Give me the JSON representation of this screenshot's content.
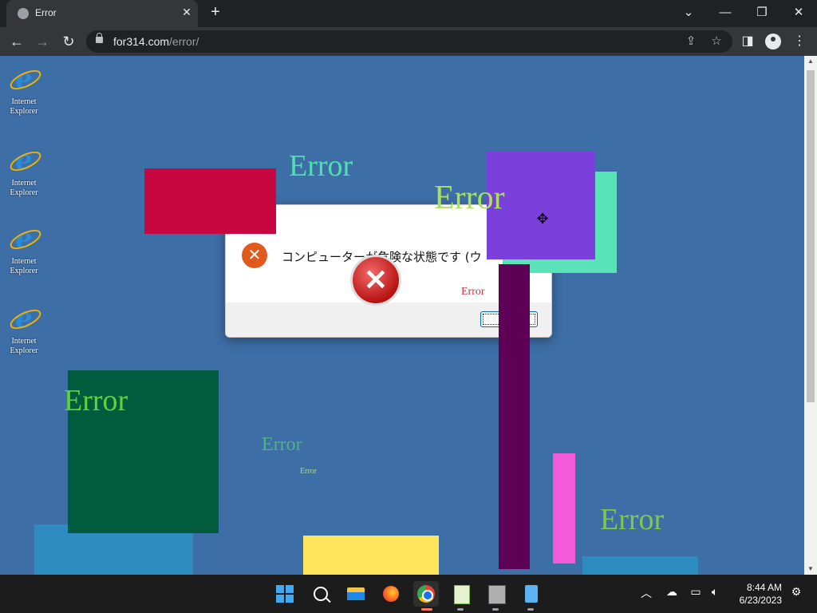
{
  "browser": {
    "tab": {
      "title": "Error"
    },
    "window_controls": {
      "tabsearch": "⌄",
      "minimize": "—",
      "restore": "❐",
      "close": "✕"
    },
    "toolbar": {
      "back": "←",
      "forward": "→",
      "reload": "↻",
      "url_host": "for314.com",
      "url_path": "/error/",
      "share": "⇪",
      "bookmark": "☆",
      "sidepanel": "◨",
      "menu": "⋮"
    }
  },
  "desktop_icons": [
    {
      "label": "Internet Explorer"
    },
    {
      "label": "Internet Explorer"
    },
    {
      "label": "Internet Explorer"
    },
    {
      "label": "Internet Explorer"
    }
  ],
  "errors": [
    {
      "text": "Error",
      "color": "#4fe0b0"
    },
    {
      "text": "Error",
      "color": "#a8e060"
    },
    {
      "text": "Error",
      "color": "#c8364a"
    },
    {
      "text": "Error",
      "color": "#5fd33a"
    },
    {
      "text": "Error",
      "color": "#4fb386"
    },
    {
      "text": "Error",
      "color": "#a8d8a0"
    },
    {
      "text": "Error",
      "color": "#7ec850"
    }
  ],
  "dialog": {
    "message": "コンピューターが危険な状態です (ウ",
    "icon": "✕",
    "ok_label": ""
  },
  "colors": {
    "page_bg": "#3e6ea6",
    "crimson": "#c8063f",
    "purple": "#7b3fdb",
    "mint": "#59e3b6",
    "dark_purple": "#5e0055",
    "dark_green": "#005c3c",
    "pink": "#f25ad9",
    "yellow": "#ffe45c",
    "teal": "#2e8bbf"
  },
  "taskbar": {
    "time": "8:44 AM",
    "date": "6/23/2023",
    "tray_chevron": "︿"
  }
}
